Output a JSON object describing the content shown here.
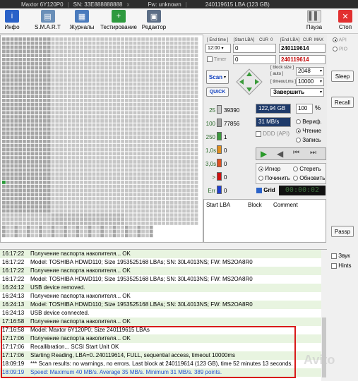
{
  "titlebar": {
    "model": "Maxtor 6Y120P0",
    "sn": "SN: 33E888888888",
    "fw": "Fw: unknown",
    "lba": "240119615 LBA (123 GB)"
  },
  "toolbar": {
    "info": "Инфо",
    "smart": "S.M.A.R.T",
    "journals": "Журналы",
    "testing": "Тестирование",
    "editor": "Редактор",
    "pause": "Пауза",
    "stop": "Стоп"
  },
  "panel": {
    "end_time_label": "[ End time ]",
    "start_lba_label": "[Start LBA]",
    "cur_label": "CUR",
    "zero_label": "0",
    "end_lba_label": "[End LBA]",
    "max_label": "MAX",
    "time_value": "12:00",
    "start_lba_value": "0",
    "end_lba_value": "240119614",
    "timer_label": "Timer",
    "timer_value": "0",
    "end_lba_value2": "240119614",
    "scan_label": "Scan",
    "quick_label": "QUICK",
    "block_size_label": "[ block size ]",
    "auto_label": "[ auto ]",
    "block_size_value": "2048",
    "timeout_label": "[ timeout,ms ]",
    "timeout_value": "10000",
    "finish_action": "Завершить",
    "capacity": "122,94 GB",
    "percent": "100",
    "percent_unit": "%",
    "speed": "31 MB/s",
    "verify": "Вериф.",
    "read": "Чтение",
    "write": "Запись",
    "ddd": "DDD (API)",
    "ignore": "Игнор",
    "erase": "Стереть",
    "repair": "Починить",
    "refresh": "Обновить",
    "grid": "Grid",
    "elapsed": "00:00:02",
    "col_start_lba": "Start LBA",
    "col_block": "Block",
    "col_comment": "Comment"
  },
  "legend": [
    {
      "label": "25",
      "count": "39390",
      "color": "#c8c8c8"
    },
    {
      "label": "100",
      "count": "77856",
      "color": "#a0a0a0"
    },
    {
      "label": "250",
      "count": "1",
      "color": "#3c9a3c"
    },
    {
      "label": "1,0s",
      "count": "0",
      "color": "#e09020"
    },
    {
      "label": "3,0s",
      "count": "0",
      "color": "#e05020"
    },
    {
      "label": ">",
      "count": "0",
      "color": "#d01010"
    },
    {
      "label": "Err",
      "count": "0",
      "color": "#2040d0"
    }
  ],
  "side": {
    "api": "API",
    "pio": "PIO",
    "sleep": "Sleep",
    "recall": "Recall",
    "passp": "Passp",
    "sound": "Звук",
    "hints": "Hints"
  },
  "log": [
    {
      "time": "16:17:22",
      "text": "Получение паспорта накопителя... OK"
    },
    {
      "time": "16:17:22",
      "text": "Model: TOSHIBA HDWD110; Size 1953525168 LBAs; SN: 30L4013NS; FW: MS2OA8R0"
    },
    {
      "time": "16:17:22",
      "text": "Получение паспорта накопителя... OK"
    },
    {
      "time": "16:17:22",
      "text": "Model: TOSHIBA HDWD110; Size 1953525168 LBAs; SN: 30L4013NS; FW: MS2OA8R0"
    },
    {
      "time": "16:24:12",
      "text": "USB device removed."
    },
    {
      "time": "16:24:13",
      "text": "Получение паспорта накопителя... OK"
    },
    {
      "time": "16:24:13",
      "text": "Model: TOSHIBA HDWD110; Size 1953525168 LBAs; SN: 30L4013NS; FW: MS2OA8R0"
    },
    {
      "time": "16:24:13",
      "text": "USB device connected."
    },
    {
      "time": "17:16:58",
      "text": "Получение паспорта накопителя... OK"
    },
    {
      "time": "17:16:58",
      "text": "Model: Maxtor 6Y120P0; Size 240119615 LBAs"
    },
    {
      "time": "17:17:06",
      "text": "Получение паспорта накопителя... OK"
    },
    {
      "time": "17:17:06",
      "text": "Recallibration... SCSI Start Unit OK"
    },
    {
      "time": "17:17:06",
      "text": "Starting Reading, LBA=0..240119614, FULL, sequential access, timeout 10000ms"
    },
    {
      "time": "18:09:19",
      "text": "*** Scan results: no warnings, no errors. Last block at 240119614 (123 GB), time 52 minutes 13 seconds."
    },
    {
      "time": "18:09:19",
      "text": "Speed: Maximum 40 MB/s. Average 35 MB/s. Minimum 31 MB/s. 389 points."
    }
  ],
  "watermark": "Avito"
}
